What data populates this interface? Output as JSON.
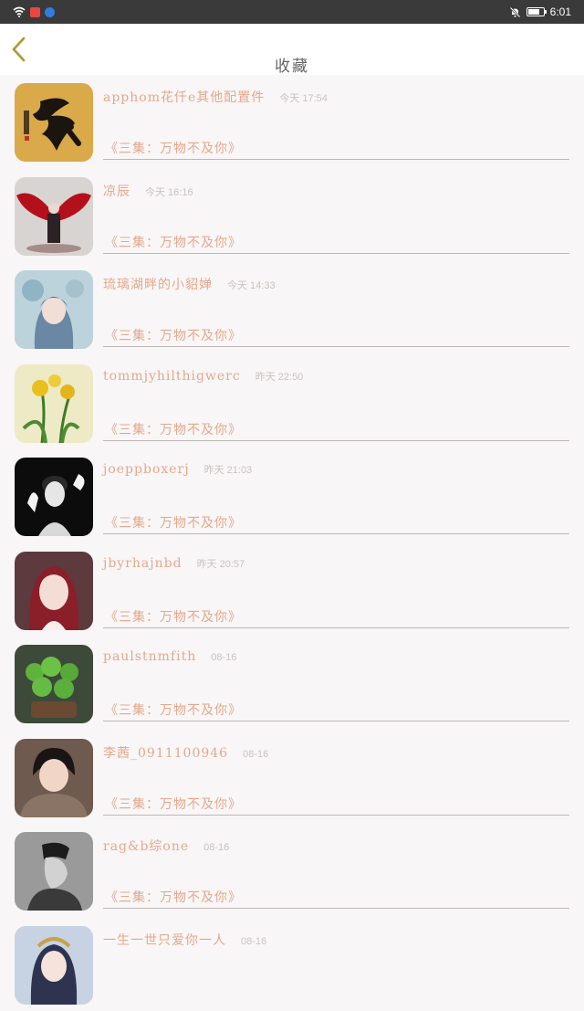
{
  "status_bar": {
    "time": "6:01"
  },
  "header": {
    "title": "收藏"
  },
  "items": [
    {
      "name": "apphom花仟e其他配置件",
      "time": "今天 17:54",
      "subtitle": "《三集：万物不及你》",
      "avatar": "fu-calligraphy"
    },
    {
      "name": "凉辰",
      "time": "今天 16:16",
      "subtitle": "《三集：万物不及你》",
      "avatar": "red-winged-angel"
    },
    {
      "name": "琉璃湖畔的小貂婵",
      "time": "今天 14:33",
      "subtitle": "《三集：万物不及你》",
      "avatar": "anime-girl-flowers"
    },
    {
      "name": "tommjyhilthigwerc",
      "time": "昨天 22:50",
      "subtitle": "《三集：万物不及你》",
      "avatar": "yellow-lilies-painting"
    },
    {
      "name": "joeppboxerj",
      "time": "昨天 21:03",
      "subtitle": "《三集：万物不及你》",
      "avatar": "mime-black-white"
    },
    {
      "name": "jbyrhajnbd",
      "time": "昨天 20:57",
      "subtitle": "《三集：万物不及你》",
      "avatar": "woman-red-hair"
    },
    {
      "name": "paulstnmfith",
      "time": "08-16",
      "subtitle": "《三集：万物不及你》",
      "avatar": "clover-plant"
    },
    {
      "name": "李茜_0911100946",
      "time": "08-16",
      "subtitle": "《三集：万物不及你》",
      "avatar": "child-portrait"
    },
    {
      "name": "rag&b综one",
      "time": "08-16",
      "subtitle": "《三集：万物不及你》",
      "avatar": "man-side-profile"
    },
    {
      "name": "一生一世只爱你一人",
      "time": "08-16",
      "subtitle": "",
      "avatar": "costume-girl"
    }
  ],
  "colors": {
    "accent": "#e4a88d",
    "time_text": "#c9c3c1",
    "back_arrow": "#c9b24a",
    "status_bar": "#3a3a3a"
  }
}
